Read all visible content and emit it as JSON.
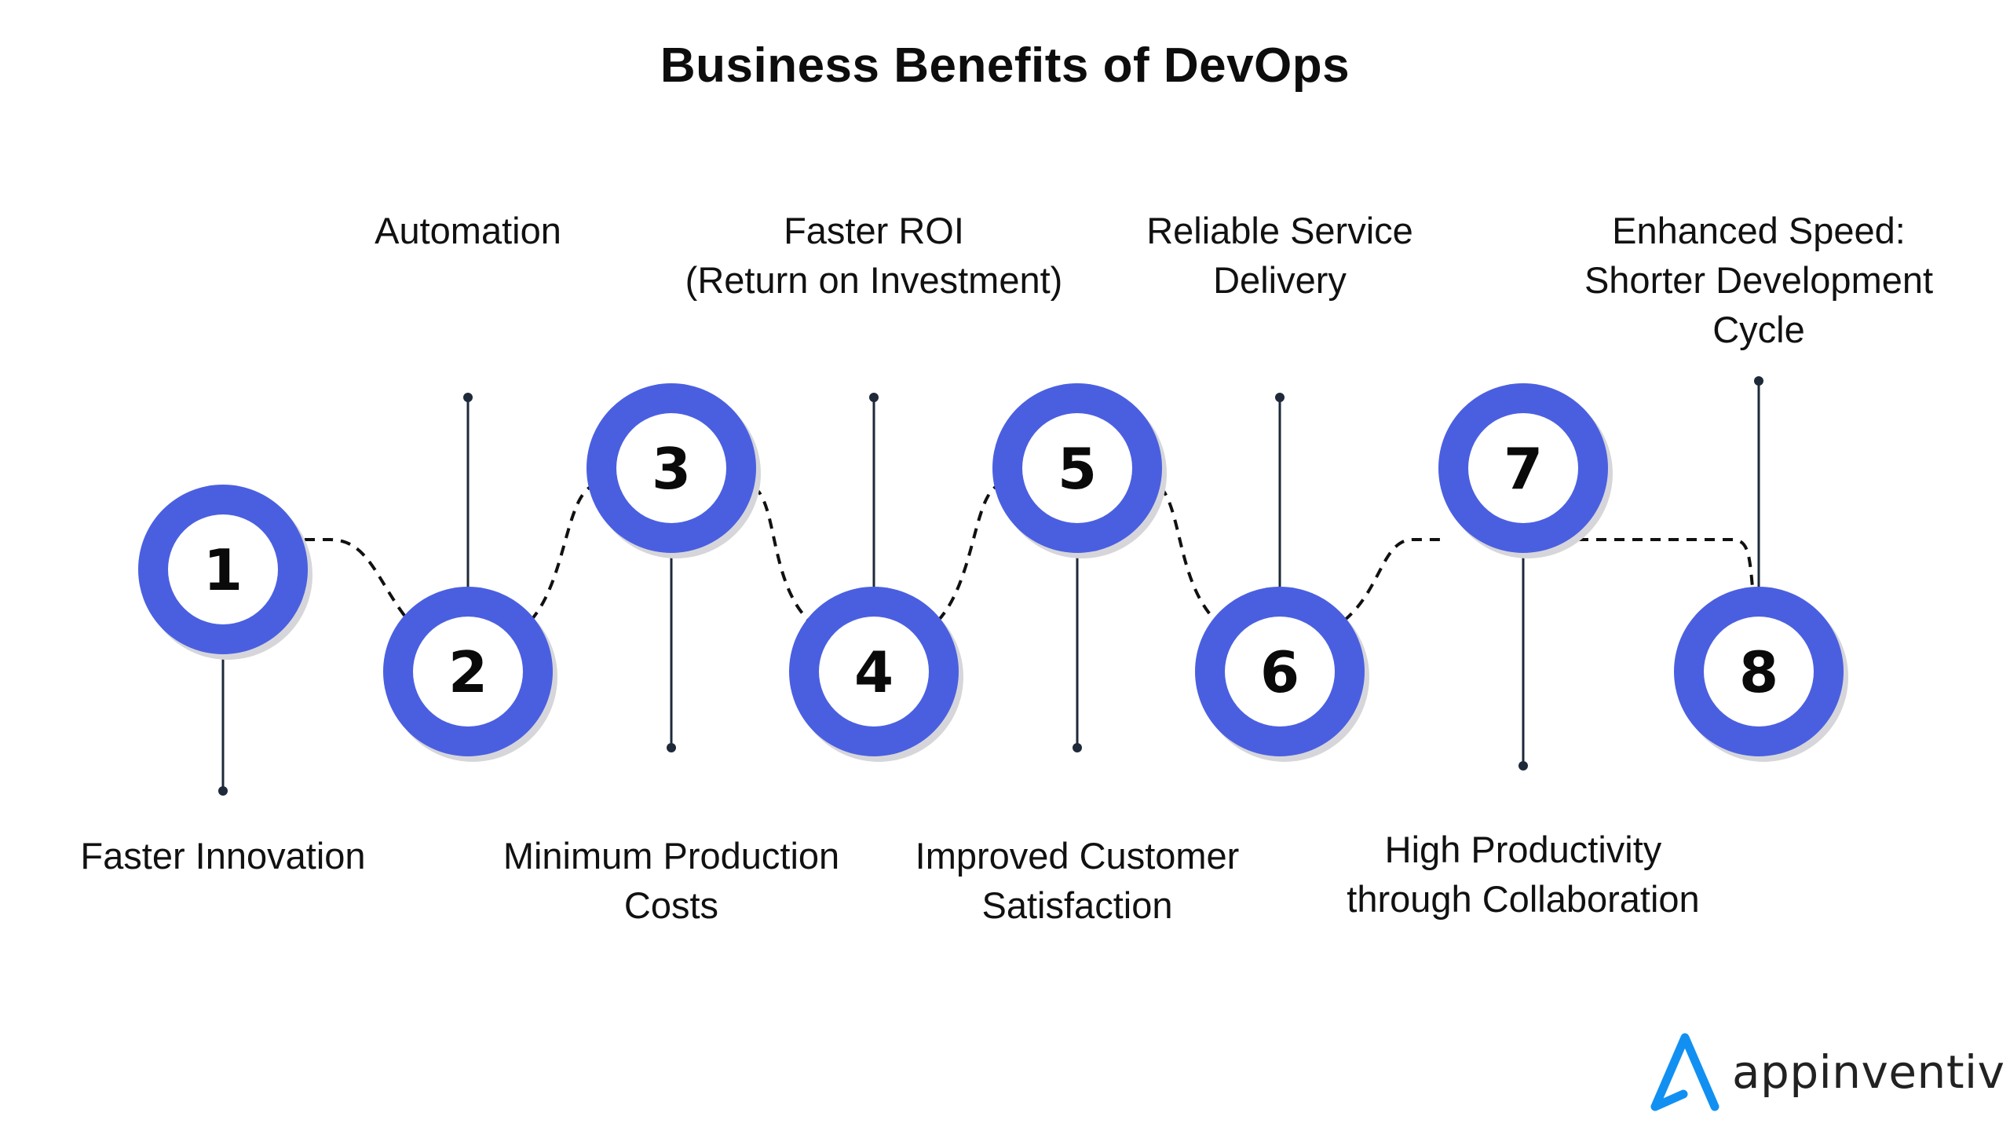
{
  "title": "Business Benefits of DevOps",
  "colors": {
    "ring": "#4a5fe0",
    "ring_shadow": "#d6d6da",
    "stem": "#1e2a3a",
    "dash": "#111111",
    "logo_mark": "#1190f2",
    "logo_text": "#222222"
  },
  "steps": [
    {
      "number": "1",
      "label": [
        "Faster Innovation"
      ],
      "label_side": "bottom",
      "row": "low-mid"
    },
    {
      "number": "2",
      "label": [
        "Automation"
      ],
      "label_side": "top",
      "row": "low"
    },
    {
      "number": "3",
      "label": [
        "Minimum Production",
        "Costs"
      ],
      "label_side": "bottom",
      "row": "high"
    },
    {
      "number": "4",
      "label": [
        "Faster ROI",
        "(Return on Investment)"
      ],
      "label_side": "top",
      "row": "low"
    },
    {
      "number": "5",
      "label": [
        "Improved Customer",
        "Satisfaction"
      ],
      "label_side": "bottom",
      "row": "high"
    },
    {
      "number": "6",
      "label": [
        "Reliable Service",
        "Delivery"
      ],
      "label_side": "top",
      "row": "low"
    },
    {
      "number": "7",
      "label": [
        "High Productivity",
        "through Collaboration"
      ],
      "label_side": "bottom",
      "row": "high"
    },
    {
      "number": "8",
      "label": [
        "Enhanced Speed:",
        "Shorter Development",
        "Cycle"
      ],
      "label_side": "top",
      "row": "low"
    }
  ],
  "logo": {
    "text": "appinventiv",
    "icon": "appinventiv-a-mark-icon"
  }
}
